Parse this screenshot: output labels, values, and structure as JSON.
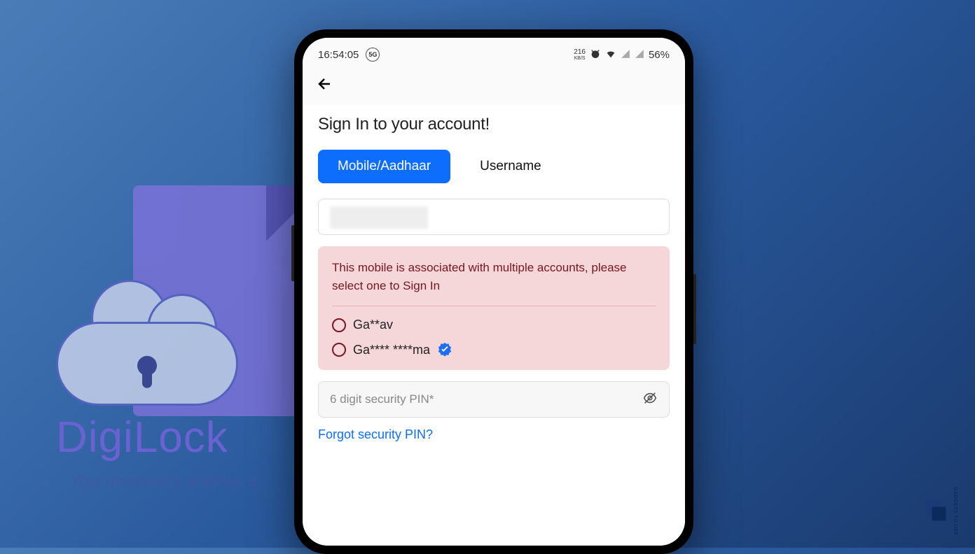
{
  "background": {
    "brand_name": "DigiLock",
    "tagline": "Your documents anytime, a"
  },
  "status_bar": {
    "time": "16:54:05",
    "network_badge": "5G",
    "speed_val": "216",
    "speed_unit": "KB/S",
    "battery": "56%"
  },
  "screen": {
    "title": "Sign In to your account!",
    "tabs": {
      "active": "Mobile/Aadhaar",
      "inactive": "Username"
    },
    "input_value": "",
    "alert": {
      "message": "This mobile is associated with multiple accounts, please select one to Sign In",
      "options": [
        {
          "label": "Ga**av",
          "verified": false
        },
        {
          "label": "Ga**** ****ma",
          "verified": true
        }
      ]
    },
    "pin_placeholder": "6 digit security PIN*",
    "forgot_link": "Forgot security PIN?"
  },
  "watermark": "GADGETS TO USE"
}
